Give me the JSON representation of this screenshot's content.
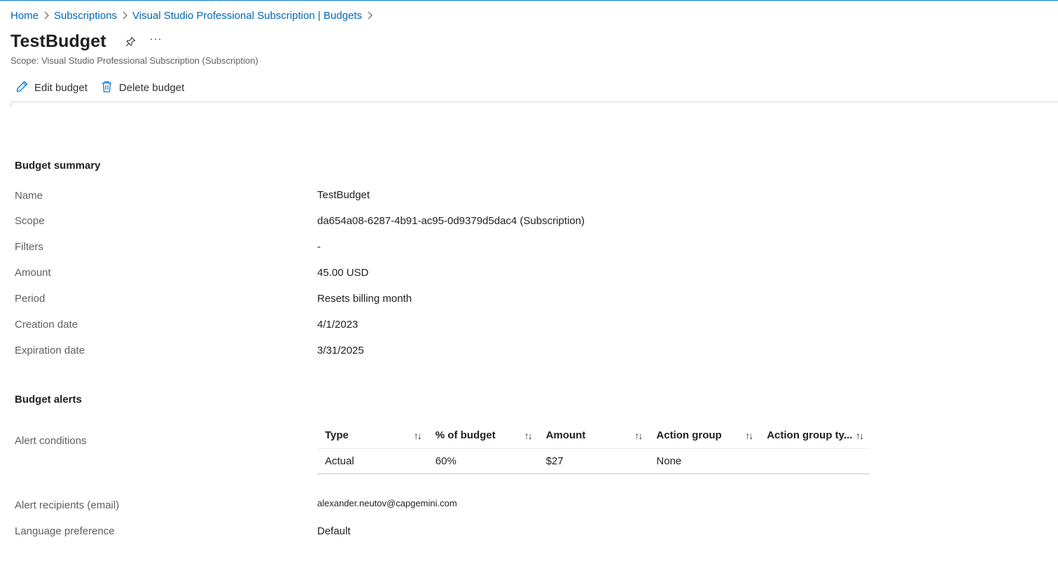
{
  "breadcrumb": {
    "items": [
      "Home",
      "Subscriptions",
      "Visual Studio Professional Subscription | Budgets"
    ]
  },
  "header": {
    "title": "TestBudget",
    "more_label": "···",
    "scope_subtitle": "Scope: Visual Studio Professional Subscription (Subscription)"
  },
  "toolbar": {
    "edit_label": "Edit budget",
    "delete_label": "Delete budget"
  },
  "summary": {
    "title": "Budget summary",
    "rows": [
      {
        "label": "Name",
        "value": "TestBudget"
      },
      {
        "label": "Scope",
        "value": "da654a08-6287-4b91-ac95-0d9379d5dac4 (Subscription)"
      },
      {
        "label": "Filters",
        "value": "-"
      },
      {
        "label": "Amount",
        "value": "45.00 USD"
      },
      {
        "label": "Period",
        "value": "Resets billing month"
      },
      {
        "label": "Creation date",
        "value": "4/1/2023"
      },
      {
        "label": "Expiration date",
        "value": "3/31/2025"
      }
    ]
  },
  "alerts": {
    "title": "Budget alerts",
    "conditions_label": "Alert conditions",
    "sort_glyph": "↑↓",
    "table": {
      "columns": [
        "Type",
        "% of budget",
        "Amount",
        "Action group",
        "Action group ty..."
      ],
      "rows": [
        [
          "Actual",
          "60%",
          "$27",
          "None",
          ""
        ]
      ]
    },
    "recipients_label": "Alert recipients (email)",
    "recipients_value": "alexander.neutov@capgemini.com",
    "language_label": "Language preference",
    "language_value": "Default"
  },
  "colors": {
    "link": "#0067b8",
    "accent": "#0078d4",
    "text": "#323130",
    "muted": "#605e5c"
  }
}
